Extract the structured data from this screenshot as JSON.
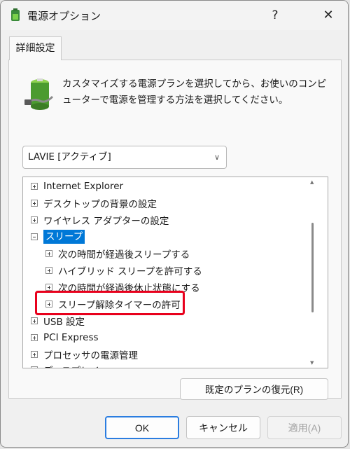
{
  "window": {
    "title": "電源オプション",
    "help_label": "?",
    "close_label": "✕"
  },
  "tabs": [
    {
      "label": "詳細設定"
    }
  ],
  "description": "カスタマイズする電源プランを選択してから、お使いのコンピューターで電源を管理する方法を選択してください。",
  "plan_select": {
    "value": "LAVIE [アクティブ]"
  },
  "tree": {
    "items": [
      {
        "label": "Internet Explorer",
        "state": "collapsed",
        "level": 0
      },
      {
        "label": "デスクトップの背景の設定",
        "state": "collapsed",
        "level": 0
      },
      {
        "label": "ワイヤレス アダプターの設定",
        "state": "collapsed",
        "level": 0
      },
      {
        "label": "スリープ",
        "state": "expanded",
        "level": 0,
        "selected": true
      },
      {
        "label": "次の時間が経過後スリープする",
        "state": "collapsed",
        "level": 1
      },
      {
        "label": "ハイブリッド スリープを許可する",
        "state": "collapsed",
        "level": 1
      },
      {
        "label": "次の時間が経過後休止状態にする",
        "state": "collapsed",
        "level": 1
      },
      {
        "label": "スリープ解除タイマーの許可",
        "state": "collapsed",
        "level": 1,
        "highlighted": true
      },
      {
        "label": "USB 設定",
        "state": "collapsed",
        "level": 0
      },
      {
        "label": "PCI Express",
        "state": "collapsed",
        "level": 0
      },
      {
        "label": "プロセッサの電源管理",
        "state": "collapsed",
        "level": 0
      },
      {
        "label": "ディスプレイ",
        "state": "collapsed",
        "level": 0
      }
    ]
  },
  "buttons": {
    "restore": "既定のプランの復元(R)",
    "ok": "OK",
    "cancel": "キャンセル",
    "apply": "適用(A)"
  },
  "colors": {
    "selection": "#0078d7",
    "highlight_border": "#e8001c",
    "default_button_border": "#2b7de0"
  },
  "icons": {
    "app": "power-options-icon",
    "battery": "battery-icon"
  }
}
